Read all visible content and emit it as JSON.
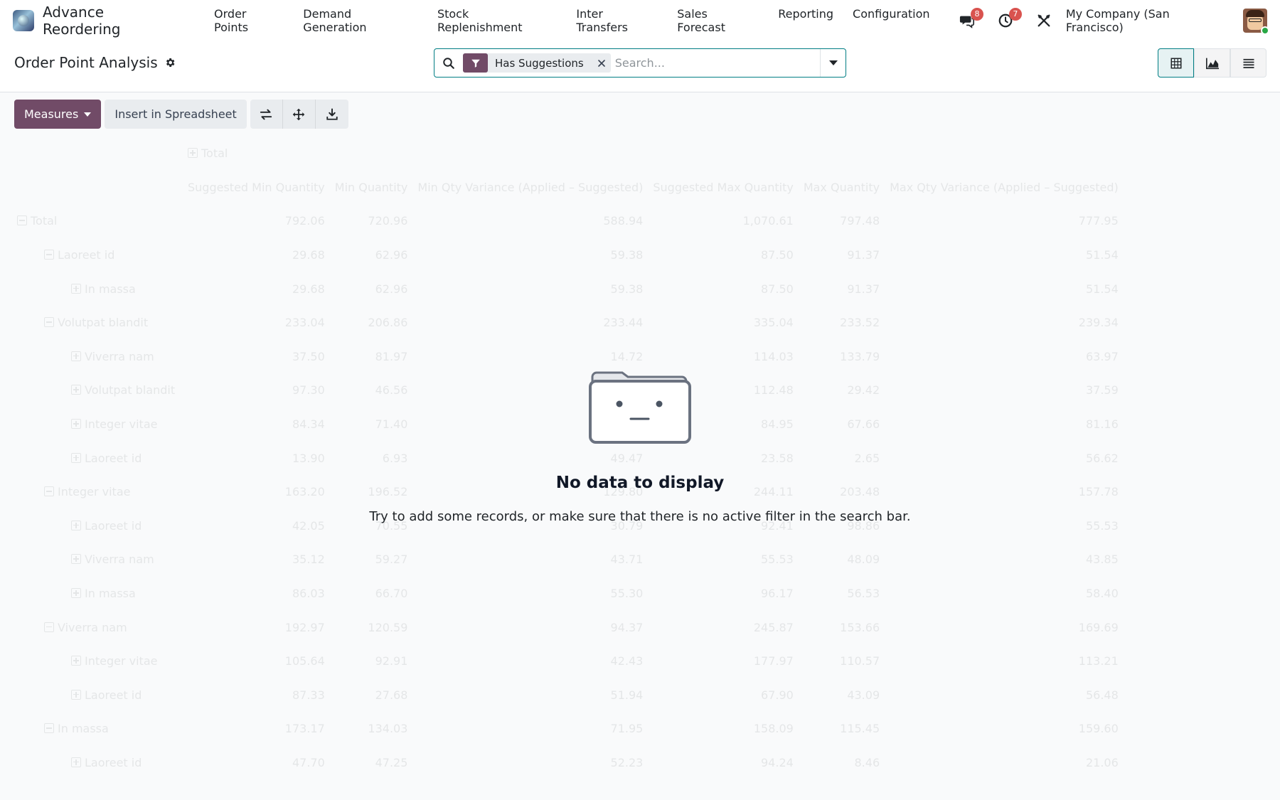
{
  "navbar": {
    "app_name": "Advance Reordering",
    "menu": [
      "Order Points",
      "Demand Generation",
      "Stock Replenishment",
      "Inter Transfers",
      "Sales Forecast",
      "Reporting",
      "Configuration"
    ],
    "messages_count": "8",
    "activities_count": "7",
    "company": "My Company (San Francisco)"
  },
  "control_panel": {
    "title": "Order Point Analysis",
    "search": {
      "facet_label": "Has Suggestions",
      "placeholder": "Search..."
    }
  },
  "toolbar": {
    "measures_label": "Measures",
    "insert_label": "Insert in Spreadsheet"
  },
  "pivot": {
    "col_header": "Total",
    "measures": [
      "Suggested Min Quantity",
      "Min Quantity",
      "Min Qty Variance (Applied – Suggested)",
      "Suggested Max Quantity",
      "Max Quantity",
      "Max Qty Variance (Applied – Suggested)"
    ],
    "rows": [
      {
        "level": 0,
        "icon": "minus",
        "label": "Total",
        "values": [
          "792.06",
          "720.96",
          "588.94",
          "1,070.61",
          "797.48",
          "777.95"
        ]
      },
      {
        "level": 1,
        "icon": "minus",
        "label": "Laoreet id",
        "values": [
          "29.68",
          "62.96",
          "59.38",
          "87.50",
          "91.37",
          "51.54"
        ]
      },
      {
        "level": 2,
        "icon": "plus",
        "label": "In massa",
        "values": [
          "29.68",
          "62.96",
          "59.38",
          "87.50",
          "91.37",
          "51.54"
        ]
      },
      {
        "level": 1,
        "icon": "minus",
        "label": "Volutpat blandit",
        "values": [
          "233.04",
          "206.86",
          "233.44",
          "335.04",
          "233.52",
          "239.34"
        ]
      },
      {
        "level": 2,
        "icon": "plus",
        "label": "Viverra nam",
        "values": [
          "37.50",
          "81.97",
          "14.72",
          "114.03",
          "133.79",
          "63.97"
        ]
      },
      {
        "level": 2,
        "icon": "plus",
        "label": "Volutpat blandit",
        "values": [
          "97.30",
          "46.56",
          "",
          "112.48",
          "29.42",
          "37.59"
        ]
      },
      {
        "level": 2,
        "icon": "plus",
        "label": "Integer vitae",
        "values": [
          "84.34",
          "71.40",
          "",
          "84.95",
          "67.66",
          "81.16"
        ]
      },
      {
        "level": 2,
        "icon": "plus",
        "label": "Laoreet id",
        "values": [
          "13.90",
          "6.93",
          "49.47",
          "23.58",
          "2.65",
          "56.62"
        ]
      },
      {
        "level": 1,
        "icon": "minus",
        "label": "Integer vitae",
        "values": [
          "163.20",
          "196.52",
          "129.80",
          "244.11",
          "203.48",
          "157.78"
        ]
      },
      {
        "level": 2,
        "icon": "plus",
        "label": "Laoreet id",
        "values": [
          "42.05",
          "70.55",
          "30.79",
          "92.41",
          "98.86",
          "55.53"
        ]
      },
      {
        "level": 2,
        "icon": "plus",
        "label": "Viverra nam",
        "values": [
          "35.12",
          "59.27",
          "43.71",
          "55.53",
          "48.09",
          "43.85"
        ]
      },
      {
        "level": 2,
        "icon": "plus",
        "label": "In massa",
        "values": [
          "86.03",
          "66.70",
          "55.30",
          "96.17",
          "56.53",
          "58.40"
        ]
      },
      {
        "level": 1,
        "icon": "minus",
        "label": "Viverra nam",
        "values": [
          "192.97",
          "120.59",
          "94.37",
          "245.87",
          "153.66",
          "169.69"
        ]
      },
      {
        "level": 2,
        "icon": "plus",
        "label": "Integer vitae",
        "values": [
          "105.64",
          "92.91",
          "42.43",
          "177.97",
          "110.57",
          "113.21"
        ]
      },
      {
        "level": 2,
        "icon": "plus",
        "label": "Laoreet id",
        "values": [
          "87.33",
          "27.68",
          "51.94",
          "67.90",
          "43.09",
          "56.48"
        ]
      },
      {
        "level": 1,
        "icon": "minus",
        "label": "In massa",
        "values": [
          "173.17",
          "134.03",
          "71.95",
          "158.09",
          "115.45",
          "159.60"
        ]
      },
      {
        "level": 2,
        "icon": "plus",
        "label": "Laoreet id",
        "values": [
          "47.70",
          "47.25",
          "52.23",
          "94.24",
          "8.46",
          "21.06"
        ]
      }
    ]
  },
  "no_content": {
    "title": "No data to display",
    "text": "Try to add some records, or make sure that there is no active filter in the search bar."
  },
  "colors": {
    "brand": "#714b67",
    "accent": "#017e84",
    "badge": "#d9534f"
  }
}
